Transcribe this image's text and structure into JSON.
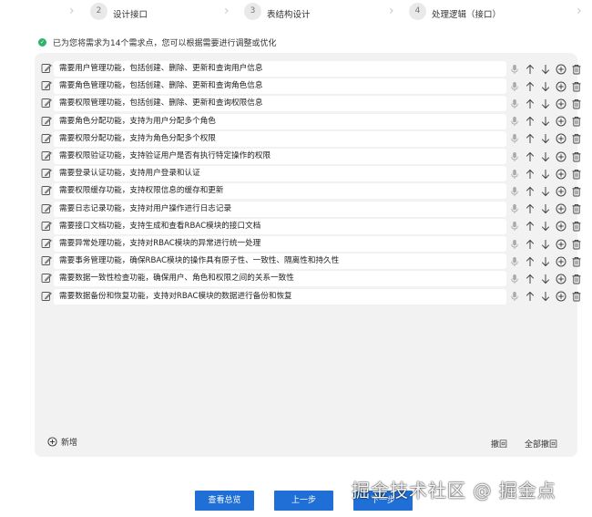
{
  "steps": [
    {
      "number": "2",
      "label": "设计接口"
    },
    {
      "number": "3",
      "label": "表结构设计"
    },
    {
      "number": "4",
      "label": "处理逻辑（接口）"
    }
  ],
  "info_text": "已为您将需求为14个需求点，您可以根据需要进行调整或优化",
  "requirements": [
    "需要用户管理功能，包括创建、删除、更新和查询用户信息",
    "需要角色管理功能，包括创建、删除、更新和查询角色信息",
    "需要权限管理功能，包括创建、删除、更新和查询权限信息",
    "需要角色分配功能，支持为用户分配多个角色",
    "需要权限分配功能，支持为角色分配多个权限",
    "需要权限验证功能，支持验证用户是否有执行特定操作的权限",
    "需要登录认证功能，支持用户登录和认证",
    "需要权限缓存功能，支持权限信息的缓存和更新",
    "需要日志记录功能，支持对用户操作进行日志记录",
    "需要接口文档功能，支持生成和查看RBAC模块的接口文档",
    "需要异常处理功能，支持对RBAC模块的异常进行统一处理",
    "需要事务管理功能，确保RBAC模块的操作具有原子性、一致性、隔离性和持久性",
    "需要数据一致性检查功能，确保用户、角色和权限之间的关系一致性",
    "需要数据备份和恢复功能，支持对RBAC模块的数据进行备份和恢复"
  ],
  "row_icons": [
    "edit-icon",
    "microphone-icon",
    "arrow-up-icon",
    "arrow-down-icon",
    "add-circle-icon",
    "trash-icon"
  ],
  "add_label": "新增",
  "undo_label": "撤回",
  "undo_all_label": "全部撤回",
  "buttons": {
    "view_summary": "查看总览",
    "previous": "上一步",
    "next": "下一步"
  },
  "watermark": "掘金技术社区 @ 掘金点",
  "colors": {
    "primary": "#1f6fd6",
    "success": "#2fb36a",
    "panel": "#f2f2f2"
  }
}
